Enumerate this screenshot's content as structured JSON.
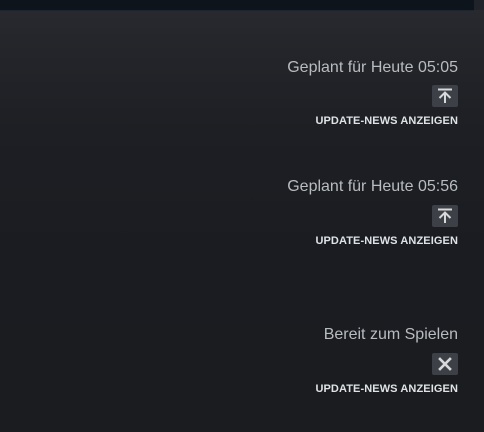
{
  "downloads": [
    {
      "status": "Geplant für Heute 05:05",
      "action_icon": "move-to-top-icon",
      "news_link": "UPDATE-NEWS ANZEIGEN"
    },
    {
      "status": "Geplant für Heute 05:56",
      "action_icon": "move-to-top-icon",
      "news_link": "UPDATE-NEWS ANZEIGEN"
    },
    {
      "status": "Bereit zum Spielen",
      "action_icon": "close-icon",
      "news_link": "UPDATE-NEWS ANZEIGEN"
    }
  ],
  "colors": {
    "status_text": "#b8bcbf",
    "link_text": "#dfe3e6",
    "button_bg": "#3d4046",
    "icon": "#d6d8da"
  }
}
